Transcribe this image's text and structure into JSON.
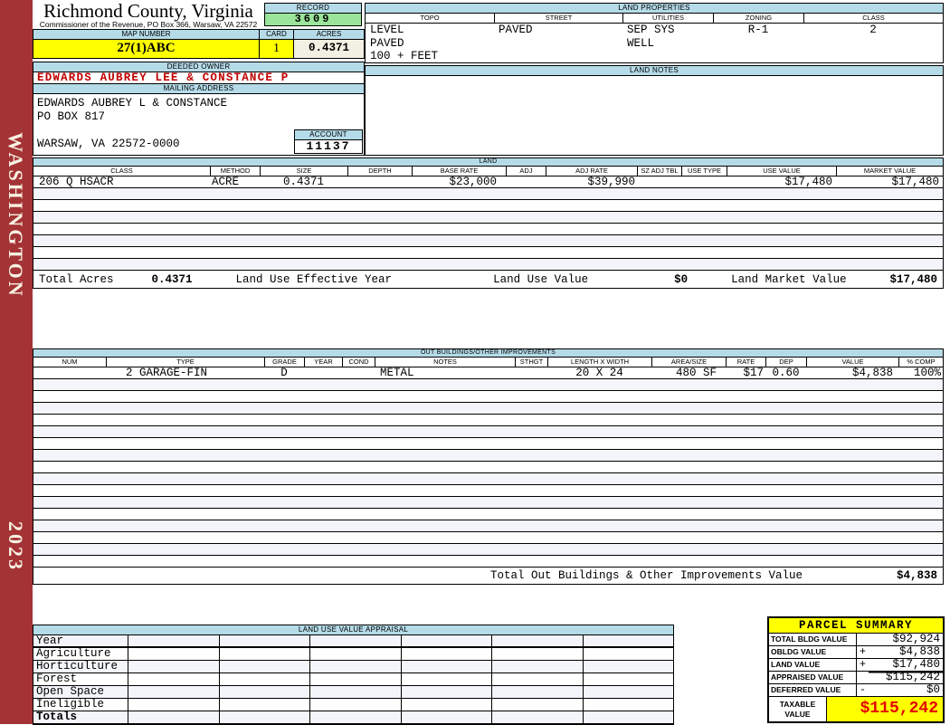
{
  "colors": {
    "sidebar_red": "#A43336",
    "header_blue": "#B5DBE8",
    "record_green": "#9BE49B",
    "highlight_yellow": "#FFFF00",
    "acres_cream": "#F1F0E2",
    "owner_red": "#C00000",
    "taxable_red": "#E60000",
    "row_stripe": "#F3F5FB"
  },
  "sidebar": {
    "county": "WASHINGTON",
    "year": "2023"
  },
  "header": {
    "title": "Richmond County, Virginia",
    "subtitle": "Commissioner of the Revenue, PO Box 366, Warsaw, VA 22572",
    "record_label": "RECORD",
    "record_value": "3609",
    "map_number_label": "MAP NUMBER",
    "map_number_value": "27(1)ABC",
    "card_label": "CARD",
    "card_value": "1",
    "acres_label": "ACRES",
    "acres_value": "0.4371"
  },
  "land_properties": {
    "title": "LAND PROPERTIES",
    "columns": [
      "TOPO",
      "STREET",
      "UTILITIES",
      "ZONING",
      "CLASS"
    ],
    "values": {
      "topo": [
        "LEVEL",
        "PAVED",
        "100 + FEET"
      ],
      "street": [
        "PAVED"
      ],
      "utilities": [
        "SEP SYS",
        "WELL"
      ],
      "zoning": [
        "R-1"
      ],
      "class": [
        "2"
      ]
    }
  },
  "owner": {
    "deeded_owner_label": "DEEDED OWNER",
    "deeded_owner": "EDWARDS AUBREY LEE & CONSTANCE P",
    "mailing_address_label": "MAILING ADDRESS",
    "mailing_lines": [
      "EDWARDS AUBREY L & CONSTANCE",
      "PO BOX 817",
      "",
      "WARSAW, VA 22572-0000"
    ],
    "account_label": "ACCOUNT",
    "account_value": "11137"
  },
  "land_notes": {
    "title": "LAND NOTES",
    "content": ""
  },
  "land": {
    "title": "LAND",
    "columns": [
      "CLASS",
      "METHOD",
      "SIZE",
      "DEPTH",
      "BASE RATE",
      "ADJ",
      "ADJ RATE",
      "SZ ADJ TBL",
      "USE TYPE",
      "USE VALUE",
      "MARKET VALUE"
    ],
    "rows": [
      [
        "206 Q HSACR",
        "ACRE",
        "0.4371",
        "",
        "$23,000",
        "",
        "$39,990",
        "",
        "",
        "$17,480",
        "$17,480"
      ]
    ],
    "empty_row_count": 7,
    "totals": {
      "total_acres_label": "Total Acres",
      "total_acres": "0.4371",
      "effective_year_label": "Land Use Effective Year",
      "effective_year": "",
      "use_value_label": "Land Use Value",
      "use_value": "$0",
      "market_value_label": "Land Market Value",
      "market_value": "$17,480"
    }
  },
  "out_buildings": {
    "title": "OUT BUILDINGS/OTHER IMPROVEMENTS",
    "columns": [
      "NUM",
      "TYPE",
      "GRADE",
      "YEAR",
      "COND",
      "NOTES",
      "STHGT",
      "LENGTH X WIDTH",
      "AREA/SIZE",
      "RATE",
      "DEP",
      "VALUE",
      "% COMP"
    ],
    "rows": [
      [
        "",
        "2 GARAGE-FIN",
        "D",
        "",
        "",
        "METAL",
        "",
        "20 X 24",
        "480 SF",
        "$17",
        "0.60",
        "$4,838",
        "100%"
      ]
    ],
    "empty_row_count": 16,
    "total_label": "Total Out Buildings & Other Improvements Value",
    "total_value": "$4,838"
  },
  "land_use_appraisal": {
    "title": "LAND USE VALUE APPRAISAL",
    "row_labels": [
      "Year",
      "Agriculture",
      "Horticulture",
      "Forest",
      "Open Space",
      "Ineligible",
      "Totals"
    ],
    "column_count": 6
  },
  "parcel_summary": {
    "title": "PARCEL SUMMARY",
    "rows": [
      {
        "label": "TOTAL BLDG VALUE",
        "op": "",
        "value": "$92,924"
      },
      {
        "label": "OBLDG VALUE",
        "op": "+",
        "value": "$4,838"
      },
      {
        "label": "LAND VALUE",
        "op": "+",
        "value": "$17,480"
      },
      {
        "label": "APPRAISED VALUE",
        "op": "",
        "value": "$115,242"
      },
      {
        "label": "DEFERRED VALUE",
        "op": "-",
        "value": "$0"
      }
    ],
    "taxable_label": "TAXABLE VALUE",
    "taxable_value": "$115,242"
  }
}
